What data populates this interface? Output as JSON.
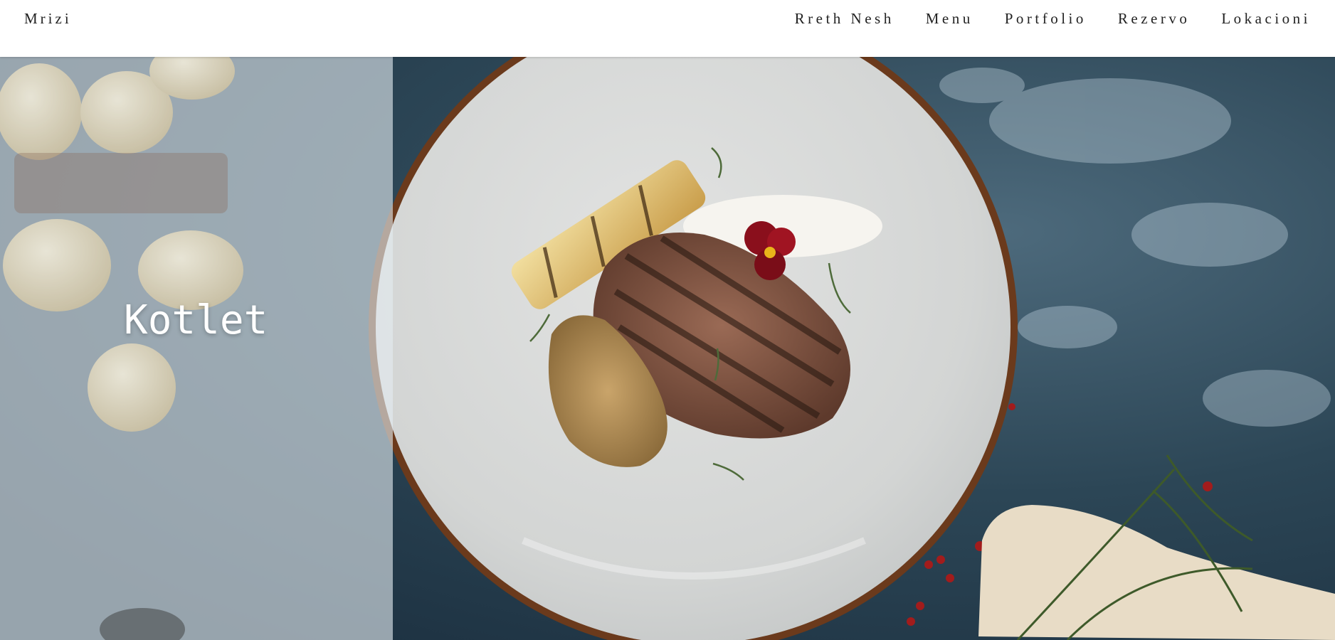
{
  "navbar": {
    "brand": "Mrizi",
    "links": [
      {
        "label": "Rreth Nesh"
      },
      {
        "label": "Menu"
      },
      {
        "label": "Portfolio"
      },
      {
        "label": "Rezervo"
      },
      {
        "label": "Lokacioni"
      }
    ]
  },
  "hero": {
    "title": "Kotlet"
  },
  "colors": {
    "navbar_bg": "#ffffff",
    "nav_text": "#222222",
    "table_bg": "#2b4454",
    "plate": "#d4d6d5",
    "plate_rim": "#6b3a1c",
    "overlay": "#dfe8ee"
  }
}
